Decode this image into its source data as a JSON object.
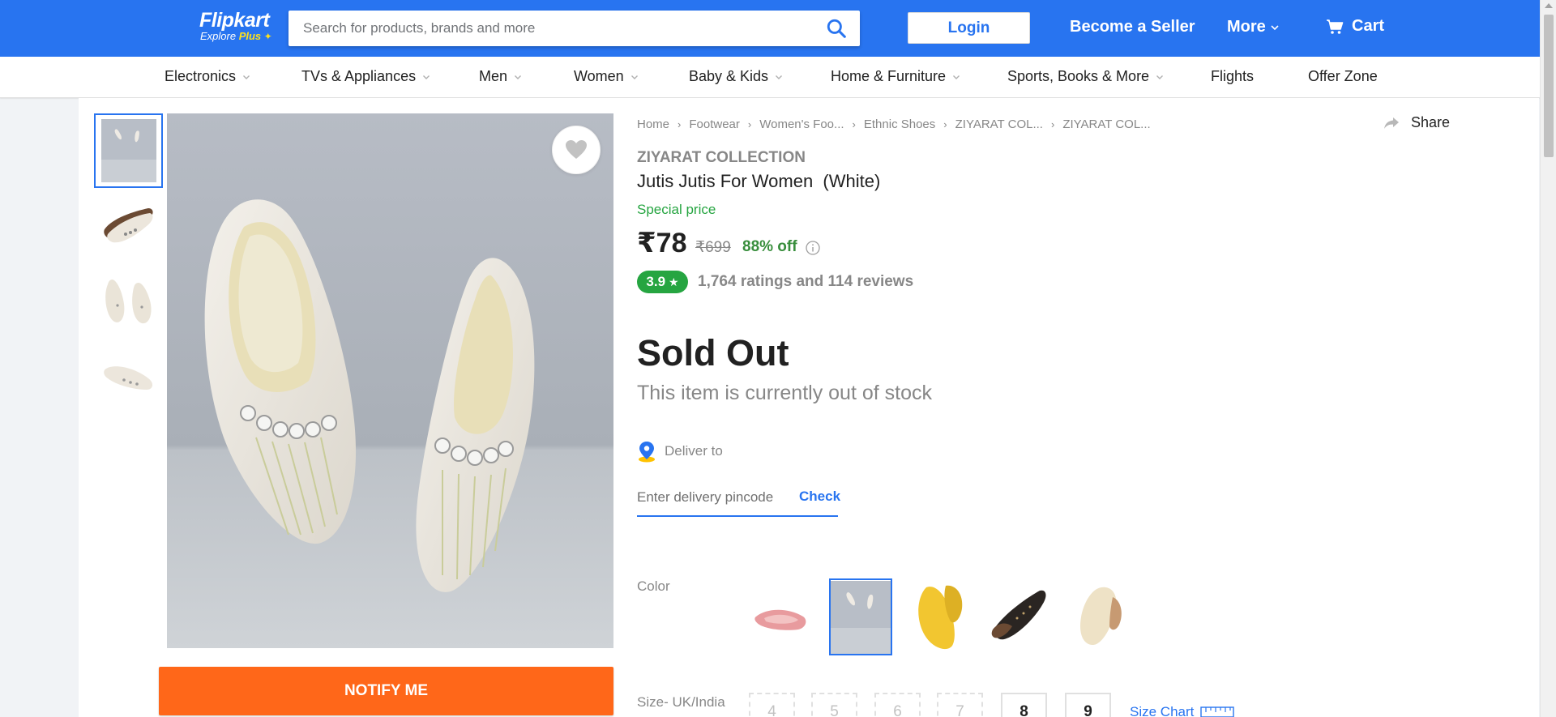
{
  "header": {
    "logo_brand": "Flipkart",
    "logo_sub": "Explore",
    "logo_plus": "Plus",
    "search_placeholder": "Search for products, brands and more",
    "login_label": "Login",
    "seller_label": "Become a Seller",
    "more_label": "More",
    "cart_label": "Cart",
    "brand_color": "#2874f0"
  },
  "categories": [
    {
      "label": "Electronics",
      "dropdown": true
    },
    {
      "label": "TVs & Appliances",
      "dropdown": true
    },
    {
      "label": "Men",
      "dropdown": true
    },
    {
      "label": "Women",
      "dropdown": true
    },
    {
      "label": "Baby & Kids",
      "dropdown": true
    },
    {
      "label": "Home & Furniture",
      "dropdown": true
    },
    {
      "label": "Sports, Books & More",
      "dropdown": true
    },
    {
      "label": "Flights",
      "dropdown": false
    },
    {
      "label": "Offer Zone",
      "dropdown": false
    }
  ],
  "breadcrumbs": [
    "Home",
    "Footwear",
    "Women's Foo...",
    "Ethnic Shoes",
    "ZIYARAT COL...",
    "ZIYARAT COL..."
  ],
  "share_label": "Share",
  "product": {
    "brand": "ZIYARAT COLLECTION",
    "title": "Jutis Jutis For Women  (White)",
    "special_label": "Special price",
    "price": "₹78",
    "mrp": "₹699",
    "discount": "88% off",
    "rating": "3.9",
    "rating_summary": "1,764 ratings and 114 reviews",
    "status_title": "Sold Out",
    "status_text": "This item is currently out of stock",
    "rating_color": "#26a541",
    "discount_color": "#388e3c"
  },
  "delivery": {
    "label": "Deliver to",
    "pincode_placeholder": "Enter delivery pincode",
    "check_label": "Check"
  },
  "color": {
    "label": "Color",
    "options": [
      "pink",
      "white",
      "yellow",
      "black",
      "cream"
    ],
    "selected": "white"
  },
  "size": {
    "label": "Size- UK/India",
    "options": [
      {
        "value": "4",
        "available": false
      },
      {
        "value": "5",
        "available": false
      },
      {
        "value": "6",
        "available": false
      },
      {
        "value": "7",
        "available": false
      },
      {
        "value": "8",
        "available": true
      },
      {
        "value": "9",
        "available": true
      }
    ],
    "chart_label": "Size Chart"
  },
  "notify_label": "NOTIFY ME",
  "notify_color": "#ff6719"
}
